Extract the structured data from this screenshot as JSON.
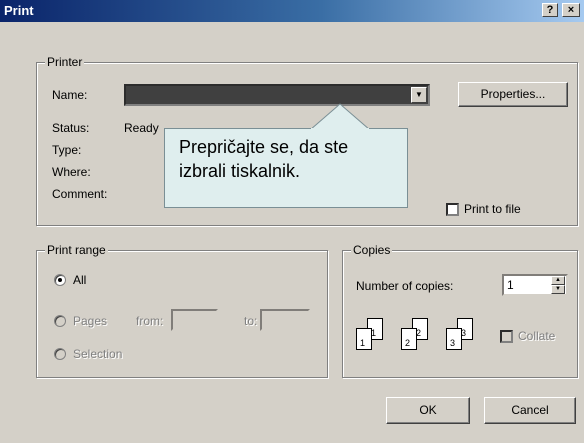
{
  "window": {
    "title": "Print",
    "help_btn": "?",
    "close_btn": "×"
  },
  "printer": {
    "group_label": "Printer",
    "name_label": "Name:",
    "name_value": "",
    "properties_label": "Properties...",
    "status_label": "Status:",
    "status_value": "Ready",
    "type_label": "Type:",
    "where_label": "Where:",
    "comment_label": "Comment:",
    "print_to_file_label": "Print to file",
    "print_to_file_checked": false
  },
  "callout": {
    "line1": "Prepričajte se, da ste",
    "line2": "izbrali tiskalnik."
  },
  "print_range": {
    "group_label": "Print range",
    "all_label": "All",
    "pages_label": "Pages",
    "from_label": "from:",
    "to_label": "to:",
    "selection_label": "Selection",
    "selected": "All"
  },
  "copies": {
    "group_label": "Copies",
    "number_label": "Number of copies:",
    "number_value": "1",
    "collate_label": "Collate",
    "collate_checked": false,
    "stack_pages": [
      "1",
      "1",
      "2",
      "2",
      "3",
      "3"
    ]
  },
  "buttons": {
    "ok": "OK",
    "cancel": "Cancel"
  },
  "icons": {
    "dropdown": "chevron-down-icon",
    "spin_up": "arrow-up-icon",
    "spin_down": "arrow-down-icon"
  }
}
